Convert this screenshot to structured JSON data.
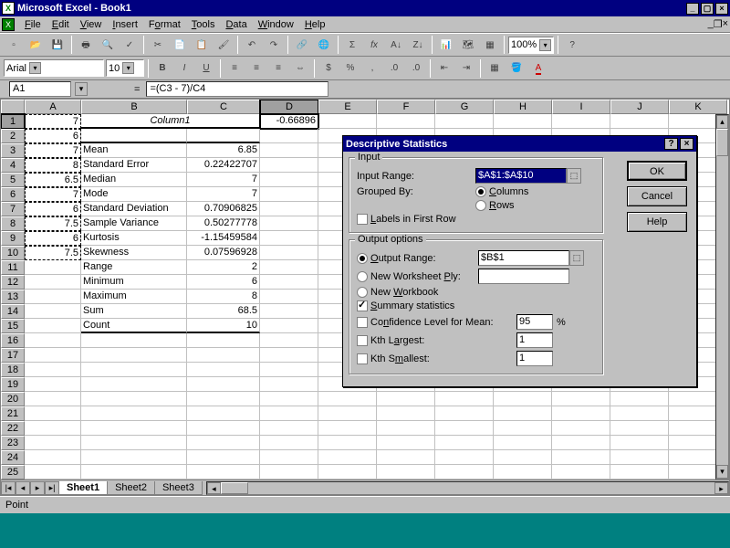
{
  "titlebar": {
    "title": "Microsoft Excel - Book1"
  },
  "menu": {
    "items": [
      "File",
      "Edit",
      "View",
      "Insert",
      "Format",
      "Tools",
      "Data",
      "Window",
      "Help"
    ]
  },
  "toolbar": {
    "zoom": "100%"
  },
  "formatbar": {
    "font": "Arial",
    "size": "10"
  },
  "formulabar": {
    "namebox": "A1",
    "formula": "=(C3 - 7)/C4",
    "fx_label": "="
  },
  "columns": [
    "A",
    "B",
    "C",
    "D",
    "E",
    "F",
    "G",
    "H",
    "I",
    "J",
    "K"
  ],
  "rows_count": 25,
  "data_a": {
    "1": "7",
    "2": "6",
    "3": "7",
    "4": "8",
    "5": "6.5",
    "6": "7",
    "7": "6",
    "8": "7.5",
    "9": "6",
    "10": "7.5"
  },
  "data_b": {
    "1": "Column1",
    "3": "Mean",
    "4": "Standard Error",
    "5": "Median",
    "6": "Mode",
    "7": "Standard Deviation",
    "8": "Sample Variance",
    "9": "Kurtosis",
    "10": "Skewness",
    "11": "Range",
    "12": "Minimum",
    "13": "Maximum",
    "14": "Sum",
    "15": "Count"
  },
  "data_c": {
    "3": "6.85",
    "4": "0.22422707",
    "5": "7",
    "6": "7",
    "7": "0.70906825",
    "8": "0.50277778",
    "9": "-1.15459584",
    "10": "0.07596928",
    "11": "2",
    "12": "6",
    "13": "8",
    "14": "68.5",
    "15": "10"
  },
  "data_d": {
    "1": "-0.66896"
  },
  "sheets": {
    "tabs": [
      "Sheet1",
      "Sheet2",
      "Sheet3"
    ],
    "active": "Sheet1"
  },
  "statusbar": {
    "text": "Point"
  },
  "dialog": {
    "title": "Descriptive Statistics",
    "group_input": "Input",
    "input_range_lbl": "Input Range:",
    "input_range_val": "$A$1:$A$10",
    "grouped_by": "Grouped By:",
    "opt_columns": "Columns",
    "opt_rows": "Rows",
    "labels_first": "Labels in First Row",
    "group_output": "Output options",
    "output_range_lbl": "Output Range:",
    "output_range_val": "$B$1",
    "new_ws": "New Worksheet Ply:",
    "new_wb": "New Workbook",
    "summary": "Summary statistics",
    "conf_lbl": "Confidence Level for Mean:",
    "conf_val": "95",
    "pct": "%",
    "kth_largest": "Kth Largest:",
    "kth_largest_val": "1",
    "kth_smallest": "Kth Smallest:",
    "kth_smallest_val": "1",
    "btn_ok": "OK",
    "btn_cancel": "Cancel",
    "btn_help": "Help"
  }
}
